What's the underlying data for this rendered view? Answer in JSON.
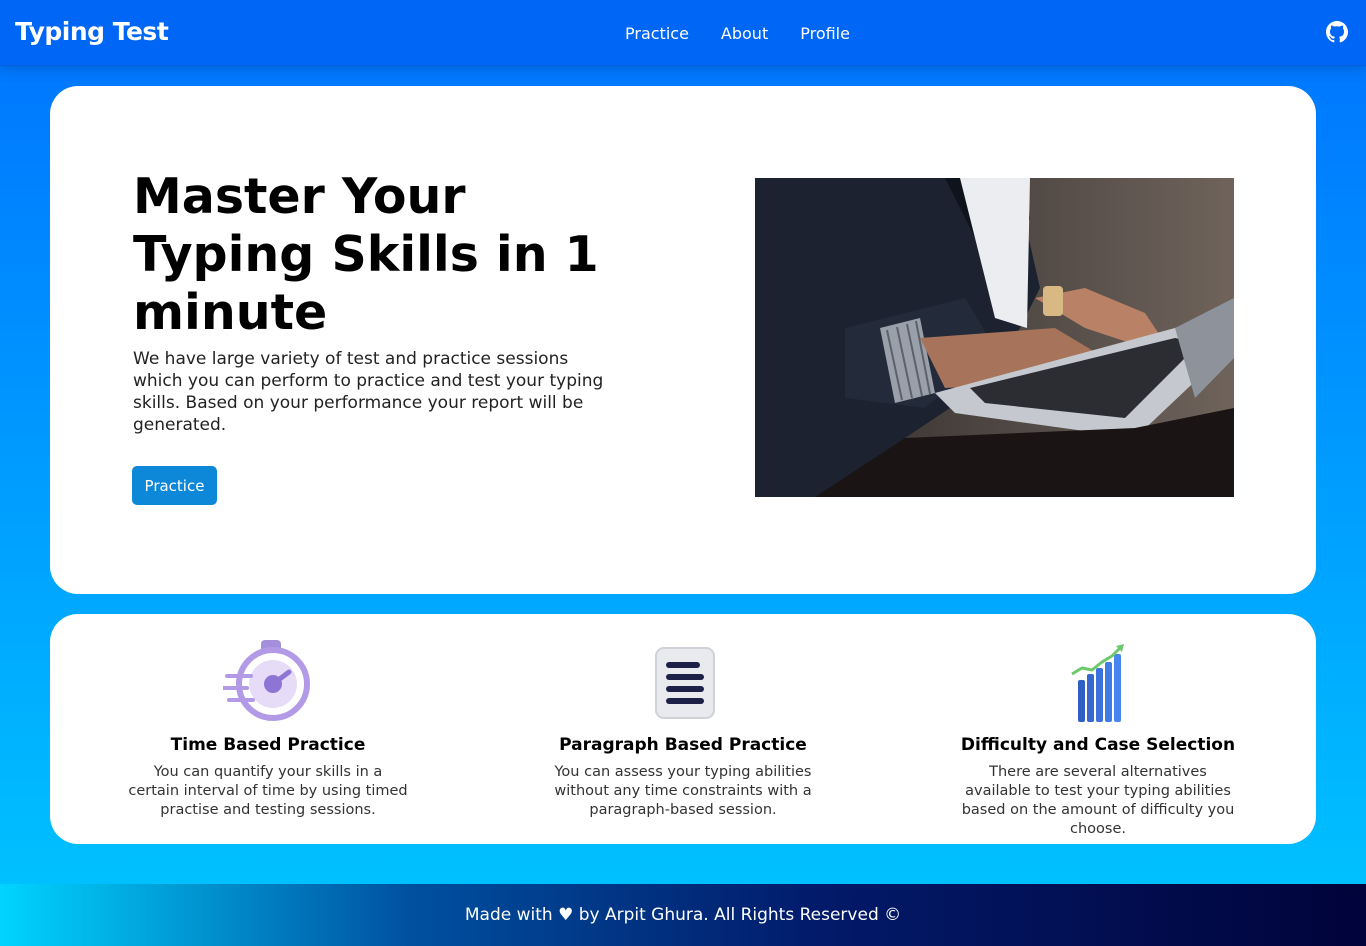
{
  "nav": {
    "brand": "Typing Test",
    "links": [
      "Practice",
      "About",
      "Profile"
    ],
    "github_icon": "github-icon"
  },
  "hero": {
    "title": "Master Your Typing Skills in 1 minute",
    "description": "We have large variety of test and practice sessions which you can perform to practice and test your typing skills. Based on your performance your report will be generated.",
    "button_label": "Practice",
    "image": "person-typing-on-laptop"
  },
  "features": [
    {
      "icon": "stopwatch-icon",
      "title": "Time Based Practice",
      "description": "You can quantify your skills in a certain interval of time by using timed practise and testing sessions."
    },
    {
      "icon": "document-lines-icon",
      "title": "Paragraph Based Practice",
      "description": "You can assess your typing abilities without any time constraints with a paragraph-based session."
    },
    {
      "icon": "bar-chart-icon",
      "title": "Difficulty and Case Selection",
      "description": "There are several alternatives available to test your typing abilities based on the amount of difficulty you choose."
    }
  ],
  "footer": {
    "text": "Made with ♥ by Arpit Ghura. All Rights Reserved ©"
  },
  "colors": {
    "nav_bg": "#0066f5",
    "button_bg": "#0d87d8",
    "gradient_top": "#0072ff",
    "gradient_bottom": "#00c6ff"
  }
}
